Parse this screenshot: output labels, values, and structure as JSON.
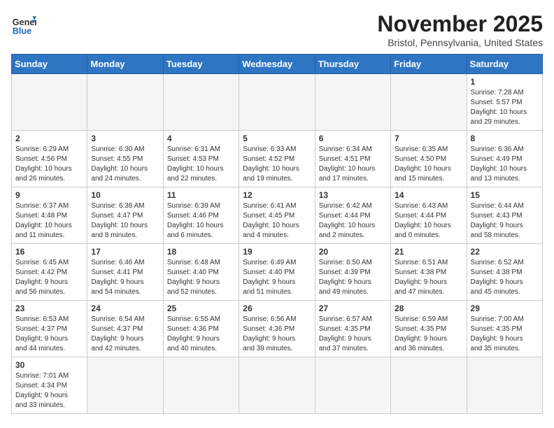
{
  "header": {
    "logo_general": "General",
    "logo_blue": "Blue",
    "month": "November 2025",
    "location": "Bristol, Pennsylvania, United States"
  },
  "weekdays": [
    "Sunday",
    "Monday",
    "Tuesday",
    "Wednesday",
    "Thursday",
    "Friday",
    "Saturday"
  ],
  "weeks": [
    [
      {
        "day": "",
        "empty": true
      },
      {
        "day": "",
        "empty": true
      },
      {
        "day": "",
        "empty": true
      },
      {
        "day": "",
        "empty": true
      },
      {
        "day": "",
        "empty": true
      },
      {
        "day": "",
        "empty": true
      },
      {
        "day": "1",
        "info": "Sunrise: 7:28 AM\nSunset: 5:57 PM\nDaylight: 10 hours\nand 29 minutes."
      }
    ],
    [
      {
        "day": "2",
        "info": "Sunrise: 6:29 AM\nSunset: 4:56 PM\nDaylight: 10 hours\nand 26 minutes."
      },
      {
        "day": "3",
        "info": "Sunrise: 6:30 AM\nSunset: 4:55 PM\nDaylight: 10 hours\nand 24 minutes."
      },
      {
        "day": "4",
        "info": "Sunrise: 6:31 AM\nSunset: 4:53 PM\nDaylight: 10 hours\nand 22 minutes."
      },
      {
        "day": "5",
        "info": "Sunrise: 6:33 AM\nSunset: 4:52 PM\nDaylight: 10 hours\nand 19 minutes."
      },
      {
        "day": "6",
        "info": "Sunrise: 6:34 AM\nSunset: 4:51 PM\nDaylight: 10 hours\nand 17 minutes."
      },
      {
        "day": "7",
        "info": "Sunrise: 6:35 AM\nSunset: 4:50 PM\nDaylight: 10 hours\nand 15 minutes."
      },
      {
        "day": "8",
        "info": "Sunrise: 6:36 AM\nSunset: 4:49 PM\nDaylight: 10 hours\nand 13 minutes."
      }
    ],
    [
      {
        "day": "9",
        "info": "Sunrise: 6:37 AM\nSunset: 4:48 PM\nDaylight: 10 hours\nand 11 minutes."
      },
      {
        "day": "10",
        "info": "Sunrise: 6:38 AM\nSunset: 4:47 PM\nDaylight: 10 hours\nand 8 minutes."
      },
      {
        "day": "11",
        "info": "Sunrise: 6:39 AM\nSunset: 4:46 PM\nDaylight: 10 hours\nand 6 minutes."
      },
      {
        "day": "12",
        "info": "Sunrise: 6:41 AM\nSunset: 4:45 PM\nDaylight: 10 hours\nand 4 minutes."
      },
      {
        "day": "13",
        "info": "Sunrise: 6:42 AM\nSunset: 4:44 PM\nDaylight: 10 hours\nand 2 minutes."
      },
      {
        "day": "14",
        "info": "Sunrise: 6:43 AM\nSunset: 4:44 PM\nDaylight: 10 hours\nand 0 minutes."
      },
      {
        "day": "15",
        "info": "Sunrise: 6:44 AM\nSunset: 4:43 PM\nDaylight: 9 hours\nand 58 minutes."
      }
    ],
    [
      {
        "day": "16",
        "info": "Sunrise: 6:45 AM\nSunset: 4:42 PM\nDaylight: 9 hours\nand 56 minutes."
      },
      {
        "day": "17",
        "info": "Sunrise: 6:46 AM\nSunset: 4:41 PM\nDaylight: 9 hours\nand 54 minutes."
      },
      {
        "day": "18",
        "info": "Sunrise: 6:48 AM\nSunset: 4:40 PM\nDaylight: 9 hours\nand 52 minutes."
      },
      {
        "day": "19",
        "info": "Sunrise: 6:49 AM\nSunset: 4:40 PM\nDaylight: 9 hours\nand 51 minutes."
      },
      {
        "day": "20",
        "info": "Sunrise: 6:50 AM\nSunset: 4:39 PM\nDaylight: 9 hours\nand 49 minutes."
      },
      {
        "day": "21",
        "info": "Sunrise: 6:51 AM\nSunset: 4:38 PM\nDaylight: 9 hours\nand 47 minutes."
      },
      {
        "day": "22",
        "info": "Sunrise: 6:52 AM\nSunset: 4:38 PM\nDaylight: 9 hours\nand 45 minutes."
      }
    ],
    [
      {
        "day": "23",
        "info": "Sunrise: 6:53 AM\nSunset: 4:37 PM\nDaylight: 9 hours\nand 44 minutes."
      },
      {
        "day": "24",
        "info": "Sunrise: 6:54 AM\nSunset: 4:37 PM\nDaylight: 9 hours\nand 42 minutes."
      },
      {
        "day": "25",
        "info": "Sunrise: 6:55 AM\nSunset: 4:36 PM\nDaylight: 9 hours\nand 40 minutes."
      },
      {
        "day": "26",
        "info": "Sunrise: 6:56 AM\nSunset: 4:36 PM\nDaylight: 9 hours\nand 39 minutes."
      },
      {
        "day": "27",
        "info": "Sunrise: 6:57 AM\nSunset: 4:35 PM\nDaylight: 9 hours\nand 37 minutes."
      },
      {
        "day": "28",
        "info": "Sunrise: 6:59 AM\nSunset: 4:35 PM\nDaylight: 9 hours\nand 36 minutes."
      },
      {
        "day": "29",
        "info": "Sunrise: 7:00 AM\nSunset: 4:35 PM\nDaylight: 9 hours\nand 35 minutes."
      }
    ],
    [
      {
        "day": "30",
        "info": "Sunrise: 7:01 AM\nSunset: 4:34 PM\nDaylight: 9 hours\nand 33 minutes."
      },
      {
        "day": "",
        "empty": true
      },
      {
        "day": "",
        "empty": true
      },
      {
        "day": "",
        "empty": true
      },
      {
        "day": "",
        "empty": true
      },
      {
        "day": "",
        "empty": true
      },
      {
        "day": "",
        "empty": true
      }
    ]
  ]
}
